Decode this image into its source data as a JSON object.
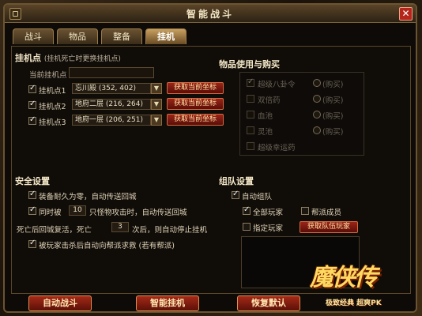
{
  "window": {
    "title": "智能战斗",
    "close_glyph": "✕"
  },
  "tabs": [
    {
      "label": "战斗"
    },
    {
      "label": "物品"
    },
    {
      "label": "整备"
    },
    {
      "label": "挂机"
    }
  ],
  "afk": {
    "title": "挂机点",
    "subtitle": "(挂机死亡时更换挂机点)",
    "current_label": "当前挂机点",
    "current_value": "",
    "points": [
      {
        "label": "挂机点1",
        "checked": true,
        "value": "忘川殿 (352, 402)",
        "button": "获取当前坐标"
      },
      {
        "label": "挂机点2",
        "checked": true,
        "value": "地府二层 (216, 264)",
        "button": "获取当前坐标"
      },
      {
        "label": "挂机点3",
        "checked": true,
        "value": "地府一层 (206, 251)",
        "button": "获取当前坐标"
      }
    ]
  },
  "items_buy": {
    "title": "物品使用与购买",
    "rows": [
      {
        "label": "超级八卦令",
        "checked": true,
        "buy": "购买"
      },
      {
        "label": "双倍药",
        "checked": false,
        "buy": "购买"
      },
      {
        "label": "血池",
        "checked": false,
        "buy": "购买"
      },
      {
        "label": "灵池",
        "checked": false,
        "buy": "购买"
      },
      {
        "label": "超级幸运药",
        "checked": false,
        "buy": "购买"
      }
    ]
  },
  "safety": {
    "title": "安全设置",
    "opt1": "装备耐久为零，自动传送回城",
    "opt2_a": "同时被",
    "opt2_num": "10",
    "opt2_b": "只怪物攻击时，自动传送回城",
    "opt3_a": "死亡后回城复活，死亡",
    "opt3_num": "3",
    "opt3_b": "次后，则自动停止挂机",
    "opt4": "被玩家击杀后自动向帮派求救 (若有帮派)"
  },
  "team": {
    "title": "组队设置",
    "auto_team": "自动组队",
    "all_players": "全部玩家",
    "guild_members": "帮派成员",
    "specified": "指定玩家",
    "get_team_button": "获取队伍玩家"
  },
  "bottom": {
    "auto_battle": "自动战斗",
    "smart_afk": "智能挂机",
    "restore_default": "恢复默认"
  },
  "logo": {
    "main": "魔侠传",
    "tagline": "极致经典 超爽PK"
  }
}
